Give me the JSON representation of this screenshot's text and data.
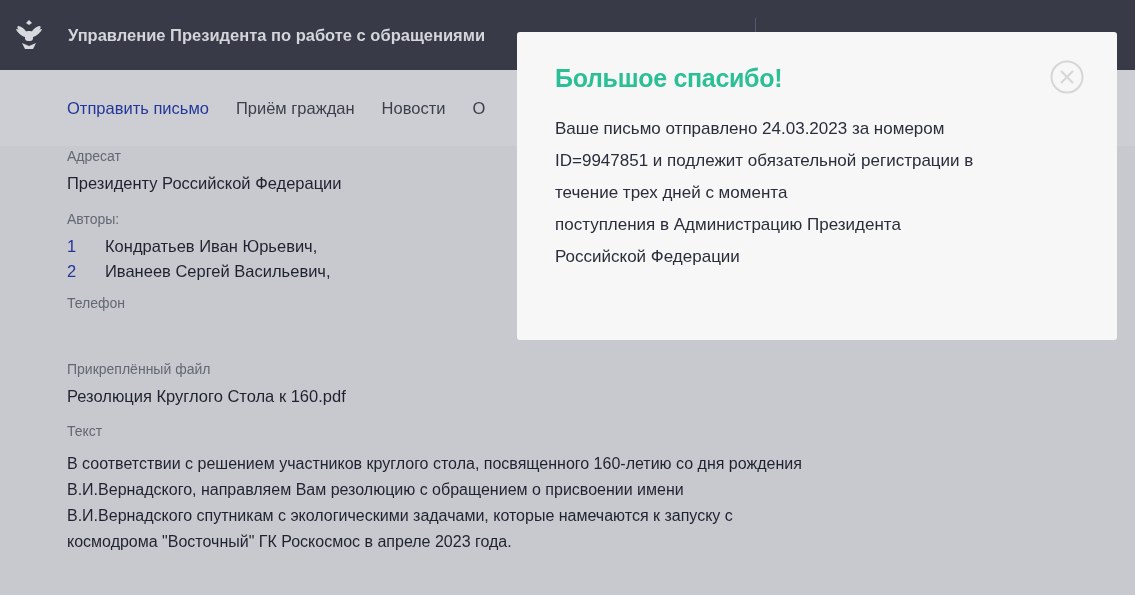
{
  "header": {
    "title": "Управление Президента по работе с обращениями"
  },
  "nav": [
    {
      "label": "Отправить письмо",
      "selected": true
    },
    {
      "label": "Приём граждан",
      "selected": false
    },
    {
      "label": "Новости",
      "selected": false
    },
    {
      "label": "О",
      "selected": false
    }
  ],
  "letter": {
    "addressee_label": "Адресат",
    "addressee": "Президенту Российской Федерации",
    "authors_label": "Авторы:",
    "authors": [
      {
        "number": "1",
        "name": "Кондратьев Иван Юрьевич,"
      },
      {
        "number": "2",
        "name": "Иванеев Сергей Васильевич,"
      }
    ],
    "phone_label": "Телефон",
    "file_label": "Прикреплённый файл",
    "file": "Резолюция Круглого Стола к 160.pdf",
    "text_label": "Текст",
    "text_lines": [
      "В соответствии с решением участников круглого стола, посвященного 160-летию со дня рождения",
      "В.И.Вернадского, направляем Вам резолюцию с обращением о присвоении имени",
      "В.И.Вернадского спутникам с экологическими задачами, которые намечаются к запуску с",
      "космодрома \"Восточный\" ГК Роскосмос в апреле 2023 года."
    ]
  },
  "dialog": {
    "title": "Большое спасибо!",
    "message_lines": [
      "Ваше письмо отправлено 24.03.2023 за номером",
      "ID=9947851 и подлежит обязательной регистрации в",
      "течение трех дней с момента",
      "поступления в Администрацию Президента",
      "Российской Федерации"
    ]
  }
}
